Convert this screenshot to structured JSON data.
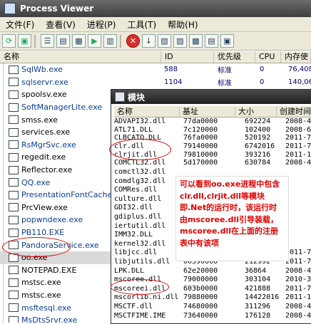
{
  "app": {
    "title": "Process Viewer"
  },
  "menu": [
    "文件(F)",
    "查看(V)",
    "进程(P)",
    "工具(T)",
    "帮助(H)"
  ],
  "columns": [
    "名称",
    "ID",
    "优先级",
    "CPU",
    "内存使"
  ],
  "processes": [
    {
      "name": "SqlWb.exe",
      "id": "588",
      "priority": "标准",
      "cpu": "0",
      "mem": "76,408"
    },
    {
      "name": "sqlservr.exe",
      "id": "1104",
      "priority": "标准",
      "cpu": "0",
      "mem": "140,06"
    },
    {
      "name": "spoolsv.exe",
      "id": "",
      "priority": "",
      "cpu": "",
      "mem": ""
    },
    {
      "name": "SoftManagerLite.exe",
      "id": "",
      "priority": "",
      "cpu": "",
      "mem": ""
    },
    {
      "name": "smss.exe",
      "id": "",
      "priority": "",
      "cpu": "",
      "mem": ""
    },
    {
      "name": "services.exe",
      "id": "",
      "priority": "",
      "cpu": "",
      "mem": ""
    },
    {
      "name": "RsMgrSvc.exe",
      "id": "",
      "priority": "",
      "cpu": "",
      "mem": ""
    },
    {
      "name": "regedit.exe",
      "id": "",
      "priority": "",
      "cpu": "",
      "mem": ""
    },
    {
      "name": "Reflector.exe",
      "id": "",
      "priority": "",
      "cpu": "",
      "mem": ""
    },
    {
      "name": "QQ.exe",
      "id": "",
      "priority": "",
      "cpu": "",
      "mem": ""
    },
    {
      "name": "PresentationFontCache.exe",
      "id": "",
      "priority": "",
      "cpu": "",
      "mem": ""
    },
    {
      "name": "PrcView.exe",
      "id": "",
      "priority": "",
      "cpu": "",
      "mem": ""
    },
    {
      "name": "popwndexe.exe",
      "id": "",
      "priority": "",
      "cpu": "",
      "mem": ""
    },
    {
      "name": "PB110.EXE",
      "id": "",
      "priority": "",
      "cpu": "",
      "mem": ""
    },
    {
      "name": "PandoraService.exe",
      "id": "",
      "priority": "",
      "cpu": "",
      "mem": ""
    },
    {
      "name": "oo.exe",
      "id": "",
      "priority": "",
      "cpu": "",
      "mem": ""
    },
    {
      "name": "NOTEPAD.EXE",
      "id": "",
      "priority": "",
      "cpu": "",
      "mem": ""
    },
    {
      "name": "mstsc.exe",
      "id": "",
      "priority": "",
      "cpu": "",
      "mem": ""
    },
    {
      "name": "mstsc.exe",
      "id": "",
      "priority": "",
      "cpu": "",
      "mem": ""
    },
    {
      "name": "msftesql.exe",
      "id": "",
      "priority": "",
      "cpu": "",
      "mem": ""
    },
    {
      "name": "MsDtsSrvr.exe",
      "id": "",
      "priority": "",
      "cpu": "",
      "mem": ""
    }
  ],
  "modules_window": {
    "title": "模块",
    "columns": [
      "名称",
      "基址",
      "大小",
      "创建时间"
    ],
    "rows": [
      {
        "name": "ADVAPI32.dll",
        "base": "77da0000",
        "size": "692224",
        "created": "2008-4"
      },
      {
        "name": "ATL71.DLL",
        "base": "7c120000",
        "size": "102400",
        "created": "2008-6"
      },
      {
        "name": "CLBCATQ.DLL",
        "base": "76fa0000",
        "size": "520192",
        "created": "2011-7"
      },
      {
        "name": "clr.dll",
        "base": "79140000",
        "size": "6742016",
        "created": "2011-7"
      },
      {
        "name": "clrjit.dll",
        "base": "79810000",
        "size": "393216",
        "created": "2011-1"
      },
      {
        "name": "COMCTL32.dll",
        "base": "5d170000",
        "size": "630784",
        "created": "2008-4"
      },
      {
        "name": "comctl32.dll",
        "base": "",
        "size": "",
        "created": ""
      },
      {
        "name": "comdlg32.dll",
        "base": "",
        "size": "",
        "created": ""
      },
      {
        "name": "COMRes.dll",
        "base": "",
        "size": "",
        "created": ""
      },
      {
        "name": "culture.dll",
        "base": "",
        "size": "",
        "created": ""
      },
      {
        "name": "GDI32.dll",
        "base": "",
        "size": "",
        "created": ""
      },
      {
        "name": "gdiplus.dll",
        "base": "",
        "size": "",
        "created": ""
      },
      {
        "name": "iertutil.dll",
        "base": "",
        "size": "",
        "created": ""
      },
      {
        "name": "IMM32.DLL",
        "base": "",
        "size": "",
        "created": ""
      },
      {
        "name": "kernel32.dll",
        "base": "",
        "size": "",
        "created": ""
      },
      {
        "name": "libjcc.dll",
        "base": "10000000",
        "size": "520192",
        "created": "2011-7"
      },
      {
        "name": "libjutils.dll",
        "base": "00390000",
        "size": "212992",
        "created": "2011-7"
      },
      {
        "name": "LPK.DLL",
        "base": "62e20000",
        "size": "36864",
        "created": "2008-4"
      },
      {
        "name": "mscoree.dll",
        "base": "79000000",
        "size": "303104",
        "created": "2010-3"
      },
      {
        "name": "mscoreei.dll",
        "base": "603b0000",
        "size": "421888",
        "created": "2011-7"
      },
      {
        "name": "mscorlib.ni.dll",
        "base": "79880000",
        "size": "14422016",
        "created": "2011-1"
      },
      {
        "name": "MSCTF.dll",
        "base": "74680000",
        "size": "311296",
        "created": "2008-4"
      },
      {
        "name": "MSCTFIME.IME",
        "base": "73640000",
        "size": "176128",
        "created": "2008-4"
      }
    ]
  },
  "annotation": {
    "text": "可以看到oo.exe进程中包含clr.dll,clrjit.dll等模块即.Net的运行时，该运行时由mscoree.dll引导装载，mscoree.dll在上面的注册表中有该项"
  }
}
